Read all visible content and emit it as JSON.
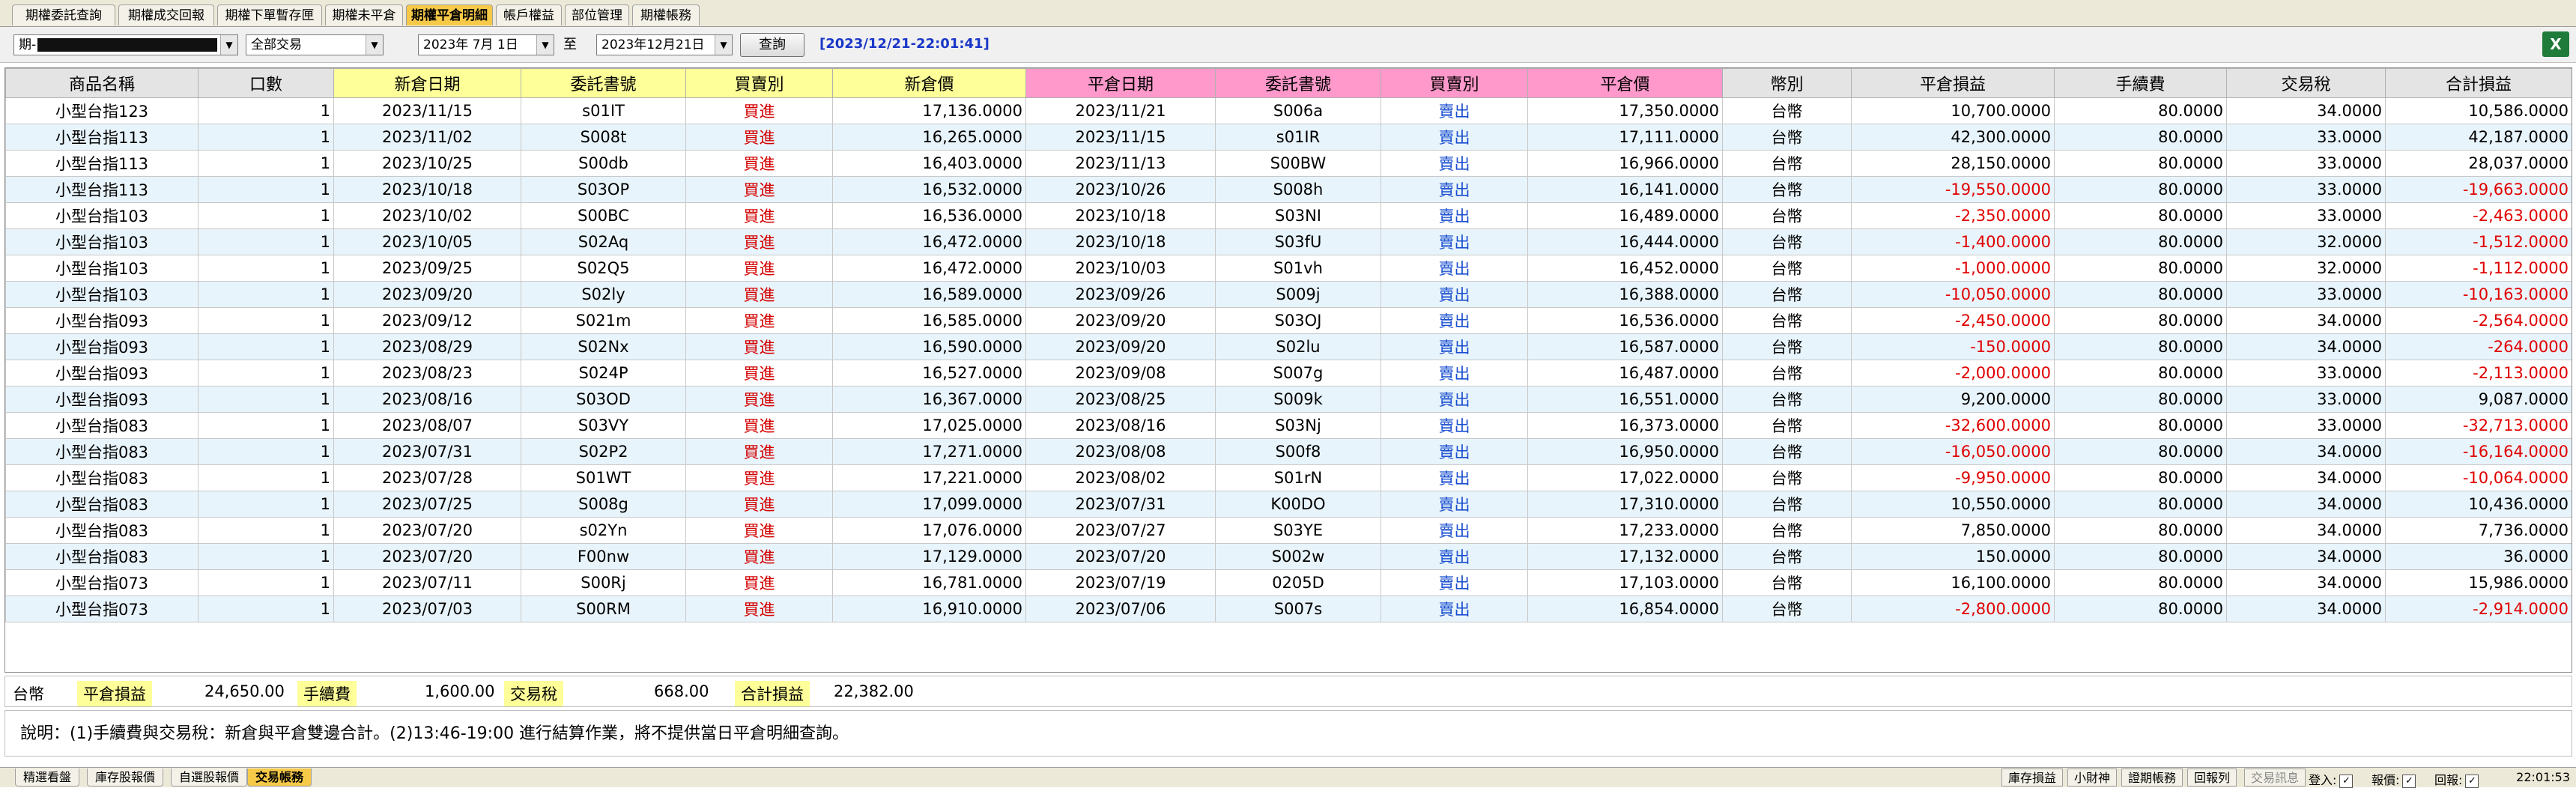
{
  "tabs": [
    "期權委託查詢",
    "期權成交回報",
    "期權下單暫存匣",
    "期權未平倉",
    "期權平倉明細",
    "帳戶權益",
    "部位管理",
    "期權帳務"
  ],
  "active_tab": 4,
  "toolbar": {
    "account_prefix": "期-",
    "trade_type": "全部交易",
    "date_from": "2023年 7月 1日",
    "date_to": "2023年12月21日",
    "separator": "至",
    "query_button": "查詢",
    "timestamp": "[2023/12/21-22:01:41]",
    "excel_icon": "excel-export-icon"
  },
  "table": {
    "headers": [
      "商品名稱",
      "口數",
      "新倉日期",
      "委託書號",
      "買賣別",
      "新倉價",
      "平倉日期",
      "委託書號",
      "買賣別",
      "平倉價",
      "幣別",
      "平倉損益",
      "手續費",
      "交易稅",
      "合計損益"
    ],
    "rows": [
      [
        "小型台指123",
        "1",
        "2023/11/15",
        "s01IT",
        "買進",
        "17,136.0000",
        "2023/11/21",
        "S006a",
        "賣出",
        "17,350.0000",
        "台幣",
        "10,700.0000",
        "80.0000",
        "34.0000",
        "10,586.0000"
      ],
      [
        "小型台指113",
        "1",
        "2023/11/02",
        "S008t",
        "買進",
        "16,265.0000",
        "2023/11/15",
        "s01IR",
        "賣出",
        "17,111.0000",
        "台幣",
        "42,300.0000",
        "80.0000",
        "33.0000",
        "42,187.0000"
      ],
      [
        "小型台指113",
        "1",
        "2023/10/25",
        "S00db",
        "買進",
        "16,403.0000",
        "2023/11/13",
        "S00BW",
        "賣出",
        "16,966.0000",
        "台幣",
        "28,150.0000",
        "80.0000",
        "33.0000",
        "28,037.0000"
      ],
      [
        "小型台指113",
        "1",
        "2023/10/18",
        "S03OP",
        "買進",
        "16,532.0000",
        "2023/10/26",
        "S008h",
        "賣出",
        "16,141.0000",
        "台幣",
        "-19,550.0000",
        "80.0000",
        "33.0000",
        "-19,663.0000"
      ],
      [
        "小型台指103",
        "1",
        "2023/10/02",
        "S00BC",
        "買進",
        "16,536.0000",
        "2023/10/18",
        "S03NI",
        "賣出",
        "16,489.0000",
        "台幣",
        "-2,350.0000",
        "80.0000",
        "33.0000",
        "-2,463.0000"
      ],
      [
        "小型台指103",
        "1",
        "2023/10/05",
        "S02Aq",
        "買進",
        "16,472.0000",
        "2023/10/18",
        "S03fU",
        "賣出",
        "16,444.0000",
        "台幣",
        "-1,400.0000",
        "80.0000",
        "32.0000",
        "-1,512.0000"
      ],
      [
        "小型台指103",
        "1",
        "2023/09/25",
        "S02Q5",
        "買進",
        "16,472.0000",
        "2023/10/03",
        "S01vh",
        "賣出",
        "16,452.0000",
        "台幣",
        "-1,000.0000",
        "80.0000",
        "32.0000",
        "-1,112.0000"
      ],
      [
        "小型台指103",
        "1",
        "2023/09/20",
        "S02ly",
        "買進",
        "16,589.0000",
        "2023/09/26",
        "S009j",
        "賣出",
        "16,388.0000",
        "台幣",
        "-10,050.0000",
        "80.0000",
        "33.0000",
        "-10,163.0000"
      ],
      [
        "小型台指093",
        "1",
        "2023/09/12",
        "S021m",
        "買進",
        "16,585.0000",
        "2023/09/20",
        "S03OJ",
        "賣出",
        "16,536.0000",
        "台幣",
        "-2,450.0000",
        "80.0000",
        "34.0000",
        "-2,564.0000"
      ],
      [
        "小型台指093",
        "1",
        "2023/08/29",
        "S02Nx",
        "買進",
        "16,590.0000",
        "2023/09/20",
        "S02lu",
        "賣出",
        "16,587.0000",
        "台幣",
        "-150.0000",
        "80.0000",
        "34.0000",
        "-264.0000"
      ],
      [
        "小型台指093",
        "1",
        "2023/08/23",
        "S024P",
        "買進",
        "16,527.0000",
        "2023/09/08",
        "S007g",
        "賣出",
        "16,487.0000",
        "台幣",
        "-2,000.0000",
        "80.0000",
        "33.0000",
        "-2,113.0000"
      ],
      [
        "小型台指093",
        "1",
        "2023/08/16",
        "S03OD",
        "買進",
        "16,367.0000",
        "2023/08/25",
        "S009k",
        "賣出",
        "16,551.0000",
        "台幣",
        "9,200.0000",
        "80.0000",
        "33.0000",
        "9,087.0000"
      ],
      [
        "小型台指083",
        "1",
        "2023/08/07",
        "S03VY",
        "買進",
        "17,025.0000",
        "2023/08/16",
        "S03Nj",
        "賣出",
        "16,373.0000",
        "台幣",
        "-32,600.0000",
        "80.0000",
        "33.0000",
        "-32,713.0000"
      ],
      [
        "小型台指083",
        "1",
        "2023/07/31",
        "S02P2",
        "買進",
        "17,271.0000",
        "2023/08/08",
        "S00f8",
        "賣出",
        "16,950.0000",
        "台幣",
        "-16,050.0000",
        "80.0000",
        "34.0000",
        "-16,164.0000"
      ],
      [
        "小型台指083",
        "1",
        "2023/07/28",
        "S01WT",
        "買進",
        "17,221.0000",
        "2023/08/02",
        "S01rN",
        "賣出",
        "17,022.0000",
        "台幣",
        "-9,950.0000",
        "80.0000",
        "34.0000",
        "-10,064.0000"
      ],
      [
        "小型台指083",
        "1",
        "2023/07/25",
        "S008g",
        "買進",
        "17,099.0000",
        "2023/07/31",
        "K00DO",
        "賣出",
        "17,310.0000",
        "台幣",
        "10,550.0000",
        "80.0000",
        "34.0000",
        "10,436.0000"
      ],
      [
        "小型台指083",
        "1",
        "2023/07/20",
        "s02Yn",
        "買進",
        "17,076.0000",
        "2023/07/27",
        "S03YE",
        "賣出",
        "17,233.0000",
        "台幣",
        "7,850.0000",
        "80.0000",
        "34.0000",
        "7,736.0000"
      ],
      [
        "小型台指083",
        "1",
        "2023/07/20",
        "F00nw",
        "買進",
        "17,129.0000",
        "2023/07/20",
        "S002w",
        "賣出",
        "17,132.0000",
        "台幣",
        "150.0000",
        "80.0000",
        "34.0000",
        "36.0000"
      ],
      [
        "小型台指073",
        "1",
        "2023/07/11",
        "S00Rj",
        "買進",
        "16,781.0000",
        "2023/07/19",
        "0205D",
        "賣出",
        "17,103.0000",
        "台幣",
        "16,100.0000",
        "80.0000",
        "34.0000",
        "15,986.0000"
      ],
      [
        "小型台指073",
        "1",
        "2023/07/03",
        "S00RM",
        "買進",
        "16,910.0000",
        "2023/07/06",
        "S007s",
        "賣出",
        "16,854.0000",
        "台幣",
        "-2,800.0000",
        "80.0000",
        "34.0000",
        "-2,914.0000"
      ]
    ]
  },
  "summary": {
    "currency": "台幣",
    "pnl_label": "平倉損益",
    "pnl_value": "24,650.00",
    "fee_label": "手續費",
    "fee_value": "1,600.00",
    "tax_label": "交易稅",
    "tax_value": "668.00",
    "total_label": "合計損益",
    "total_value": "22,382.00"
  },
  "note": "說明：(1)手續費與交易稅：新倉與平倉雙邊合計。(2)13:46-19:00 進行結算作業，將不提供當日平倉明細查詢。",
  "bottom_tabs": [
    "精選看盤",
    "庫存股報價",
    "自選股報價",
    "交易帳務"
  ],
  "bottom_active": 3,
  "status_buttons": [
    "庫存損益",
    "小財神",
    "證期帳務",
    "回報列",
    "交易訊息"
  ],
  "status_checks": [
    {
      "label": "登入:",
      "mark": "✓"
    },
    {
      "label": "報價:",
      "mark": "✓"
    },
    {
      "label": "回報:",
      "mark": "✓"
    }
  ],
  "clock": "22:01:53"
}
